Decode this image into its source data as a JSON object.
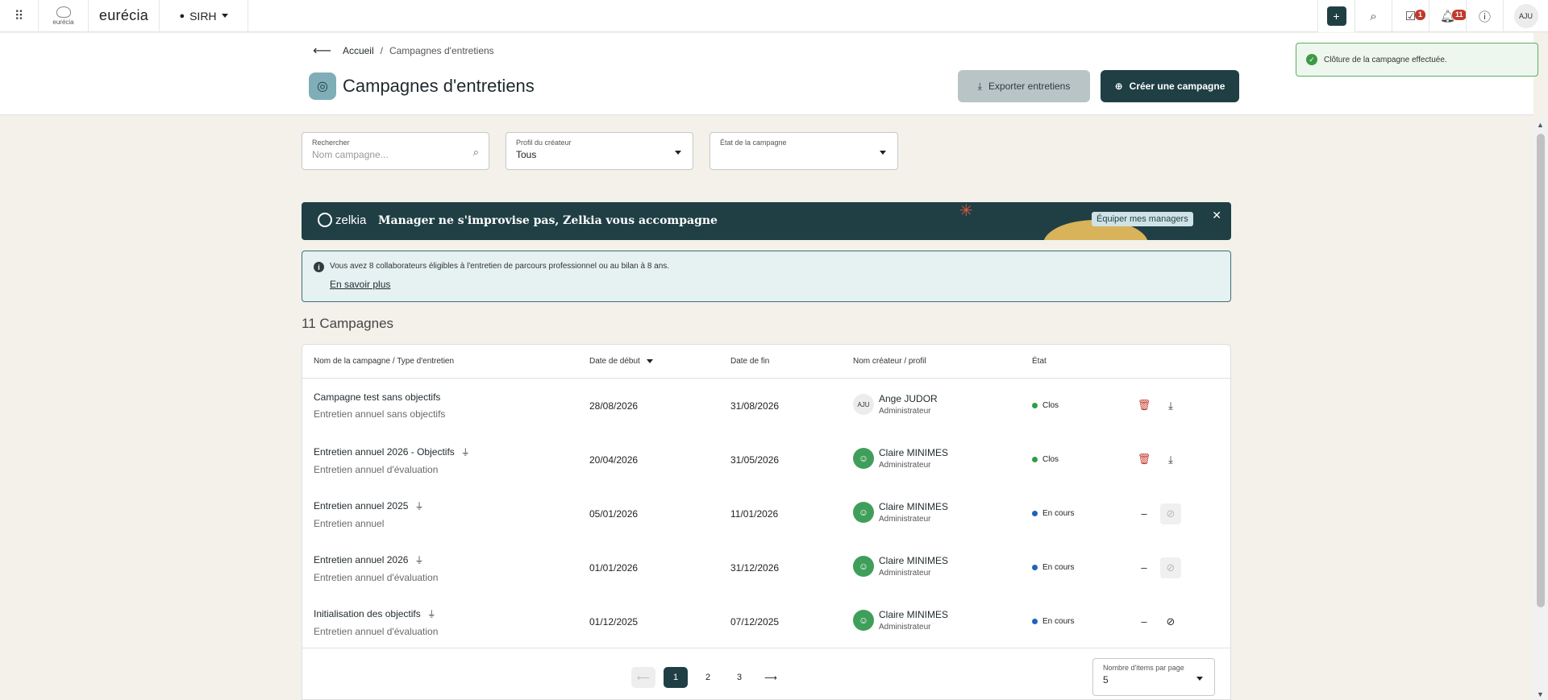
{
  "topbar": {
    "logo_small_text": "eurécia",
    "brand": "eurécia",
    "module": "SIRH",
    "tasks_badge": "1",
    "notifications_badge": "11",
    "user_initials": "AJU"
  },
  "breadcrumb": {
    "home": "Accueil",
    "separator": "/",
    "current": "Campagnes d'entretiens"
  },
  "page": {
    "title": "Campagnes d'entretiens",
    "export_label": "Exporter entretiens",
    "create_label": "Créer une campagne"
  },
  "toast": {
    "message": "Clôture de la campagne effectuée."
  },
  "filters": {
    "search": {
      "label": "Rechercher",
      "placeholder": "Nom campagne..."
    },
    "creator_profile": {
      "label": "Profil du créateur",
      "value": "Tous"
    },
    "campaign_state": {
      "label": "État de la campagne",
      "value": ""
    }
  },
  "promo": {
    "brand": "zelkia",
    "message": "Manager ne s'improvise pas, Zelkia vous accompagne",
    "cta": "Équiper mes managers"
  },
  "info": {
    "text": "Vous avez 8 collaborateurs éligibles à l'entretien de parcours professionnel ou au bilan à 8 ans.",
    "link": "En savoir plus"
  },
  "count_label": "11 Campagnes",
  "table": {
    "headers": {
      "name": "Nom de la campagne / Type d'entretien",
      "start": "Date de début",
      "end": "Date de fin",
      "creator": "Nom créateur / profil",
      "state": "État"
    },
    "rows": [
      {
        "name": "Campagne test sans objectifs",
        "type": "Entretien annuel sans objectifs",
        "start": "28/08/2026",
        "end": "31/08/2026",
        "creator": "Ange JUDOR",
        "initials": "AJU",
        "profile": "Administrateur",
        "state": "Clos",
        "state_color": "#2e9e44",
        "has_filter": false,
        "action1": "delete",
        "action2": "download"
      },
      {
        "name": "Entretien annuel 2026 - Objectifs",
        "type": "Entretien annuel d'évaluation",
        "start": "20/04/2026",
        "end": "31/05/2026",
        "creator": "Claire MINIMES",
        "initials": "",
        "profile": "Administrateur",
        "state": "Clos",
        "state_color": "#2e9e44",
        "has_filter": true,
        "action1": "delete",
        "action2": "download"
      },
      {
        "name": "Entretien annuel 2025",
        "type": "Entretien annuel",
        "start": "05/01/2026",
        "end": "11/01/2026",
        "creator": "Claire MINIMES",
        "initials": "",
        "profile": "Administrateur",
        "state": "En cours",
        "state_color": "#1e63b8",
        "has_filter": true,
        "action1": "dash",
        "action2": "close-disabled"
      },
      {
        "name": "Entretien annuel 2026",
        "type": "Entretien annuel d'évaluation",
        "start": "01/01/2026",
        "end": "31/12/2026",
        "creator": "Claire MINIMES",
        "initials": "",
        "profile": "Administrateur",
        "state": "En cours",
        "state_color": "#1e63b8",
        "has_filter": true,
        "action1": "dash",
        "action2": "close-disabled"
      },
      {
        "name": "Initialisation des objectifs",
        "type": "Entretien annuel d'évaluation",
        "start": "01/12/2025",
        "end": "07/12/2025",
        "creator": "Claire MINIMES",
        "initials": "",
        "profile": "Administrateur",
        "state": "En cours",
        "state_color": "#1e63b8",
        "has_filter": true,
        "action1": "dash",
        "action2": "close"
      }
    ]
  },
  "pagination": {
    "pages": [
      "1",
      "2",
      "3"
    ],
    "current": "1",
    "per_page_label": "Nombre d'items par page",
    "per_page_value": "5"
  },
  "colors": {
    "primary": "#1f3f45",
    "danger": "#c0392b",
    "success": "#2e9e44",
    "info": "#1e63b8"
  }
}
